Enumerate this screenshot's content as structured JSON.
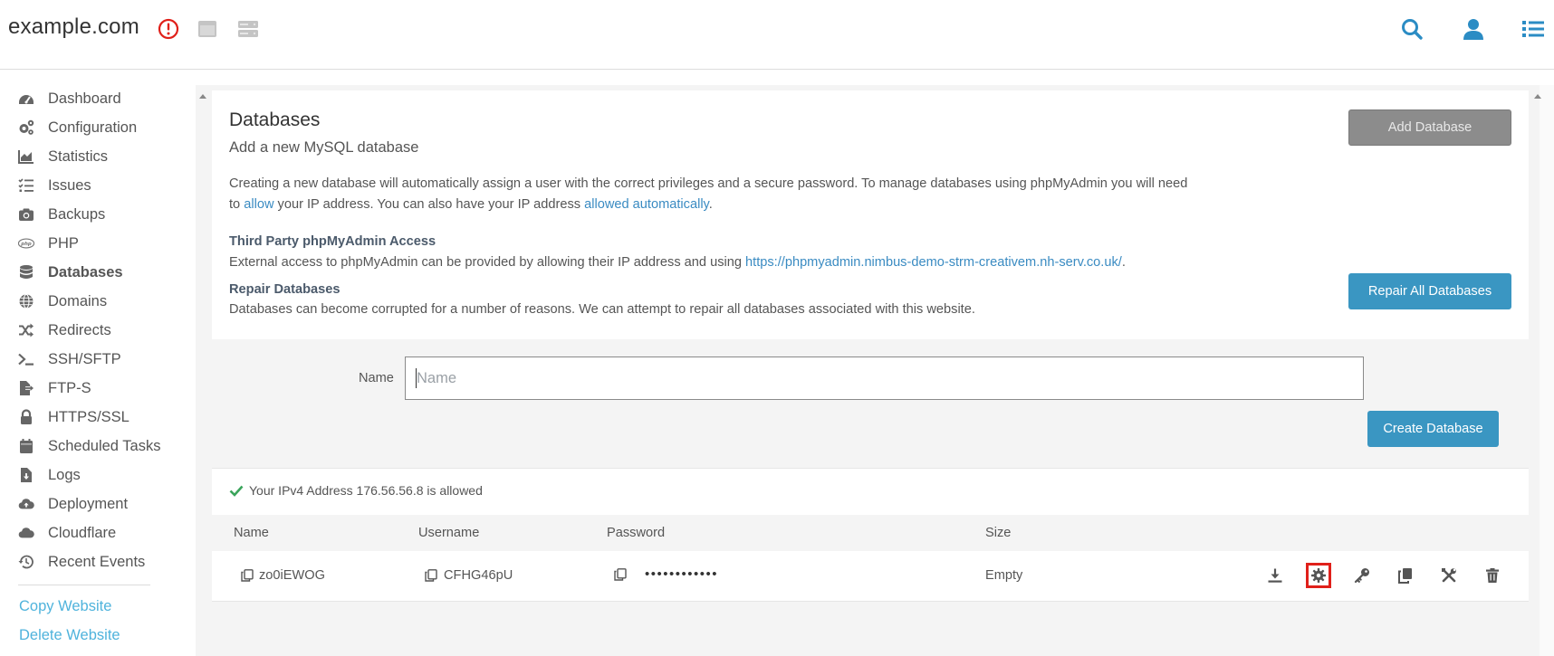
{
  "header": {
    "site_title": "example.com",
    "icons": [
      "alert-icon",
      "panel-icon",
      "server-icon",
      "search-icon",
      "user-icon",
      "menu-list-icon"
    ],
    "colors": {
      "alert": "#e0201a",
      "accent": "#2b8cc4"
    }
  },
  "sidebar": {
    "items": [
      {
        "label": "Dashboard",
        "icon": "dashboard-icon"
      },
      {
        "label": "Configuration",
        "icon": "gears-icon"
      },
      {
        "label": "Statistics",
        "icon": "chart-icon"
      },
      {
        "label": "Issues",
        "icon": "checklist-icon"
      },
      {
        "label": "Backups",
        "icon": "camera-icon"
      },
      {
        "label": "PHP",
        "icon": "php-icon"
      },
      {
        "label": "Databases",
        "icon": "database-icon",
        "active": true
      },
      {
        "label": "Domains",
        "icon": "globe-icon"
      },
      {
        "label": "Redirects",
        "icon": "shuffle-icon"
      },
      {
        "label": "SSH/SFTP",
        "icon": "terminal-icon"
      },
      {
        "label": "FTP-S",
        "icon": "file-export-icon"
      },
      {
        "label": "HTTPS/SSL",
        "icon": "lock-icon"
      },
      {
        "label": "Scheduled Tasks",
        "icon": "calendar-icon"
      },
      {
        "label": "Logs",
        "icon": "file-download-icon"
      },
      {
        "label": "Deployment",
        "icon": "cloud-upload-icon"
      },
      {
        "label": "Cloudflare",
        "icon": "cloud-icon"
      },
      {
        "label": "Recent Events",
        "icon": "history-icon"
      }
    ],
    "links": [
      "Copy Website",
      "Delete Website"
    ]
  },
  "main": {
    "title": "Databases",
    "subtitle": "Add a new MySQL database",
    "desc": {
      "part1": "Creating a new database will automatically assign a user with the correct privileges and a secure password. To manage databases using phpMyAdmin you will need to ",
      "link1": "allow",
      "part2": " your IP address. You can also have your IP address ",
      "link2": "allowed automatically",
      "part3": "."
    },
    "third_party": {
      "heading": "Third Party phpMyAdmin Access",
      "text": "External access to phpMyAdmin can be provided by allowing their IP address and using ",
      "link": "https://phpmyadmin.nimbus-demo-strm-creativem.nh-serv.co.uk/",
      "end": "."
    },
    "repair": {
      "heading": "Repair Databases",
      "text": "Databases can become corrupted for a number of reasons. We can attempt to repair all databases associated with this website."
    },
    "add_button": "Add Database",
    "repair_button": "Repair All Databases",
    "form": {
      "name_label": "Name",
      "name_placeholder": "Name",
      "name_value": "",
      "create_button": "Create Database"
    },
    "ip_status": "Your IPv4 Address 176.56.56.8 is allowed"
  },
  "table": {
    "columns": [
      "Name",
      "Username",
      "Password",
      "Size"
    ],
    "rows": [
      {
        "name": "zo0iEWOG",
        "username": "CFHG46pU",
        "password": "••••••••••••",
        "size": "Empty"
      }
    ],
    "actions": [
      "download-icon",
      "settings-gear-icon",
      "key-icon",
      "copy-icon",
      "tools-icon",
      "trash-icon"
    ],
    "highlighted_action": "settings-gear-icon"
  }
}
